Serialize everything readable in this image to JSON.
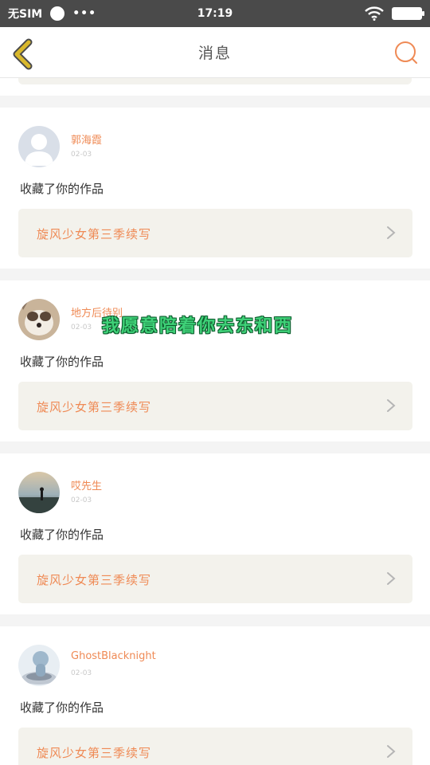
{
  "status_bar": {
    "carrier": "无SIM",
    "dots": "•••",
    "time": "17:19"
  },
  "header": {
    "title": "消息",
    "back_icon": "chevron-left-icon",
    "search_icon": "search-icon"
  },
  "colors": {
    "accent": "#ef8a55",
    "back_arrow": "#d9b82c",
    "overlay_text": "#3fd178"
  },
  "notifications": [
    {
      "username": "郭海霞",
      "date": "02-03",
      "action": "收藏了你的作品",
      "work_title": "旋风少女第三季续写"
    },
    {
      "username": "地方后待别",
      "date": "02-03",
      "action": "收藏了你的作品",
      "work_title": "旋风少女第三季续写"
    },
    {
      "username": "哎先生",
      "date": "02-03",
      "action": "收藏了你的作品",
      "work_title": "旋风少女第三季续写"
    },
    {
      "username": "GhostBlacknight",
      "date": "02-03",
      "action": "收藏了你的作品",
      "work_title": "旋风少女第三季续写"
    }
  ],
  "overlay": {
    "text": "我愿意陪着你去东和西"
  }
}
